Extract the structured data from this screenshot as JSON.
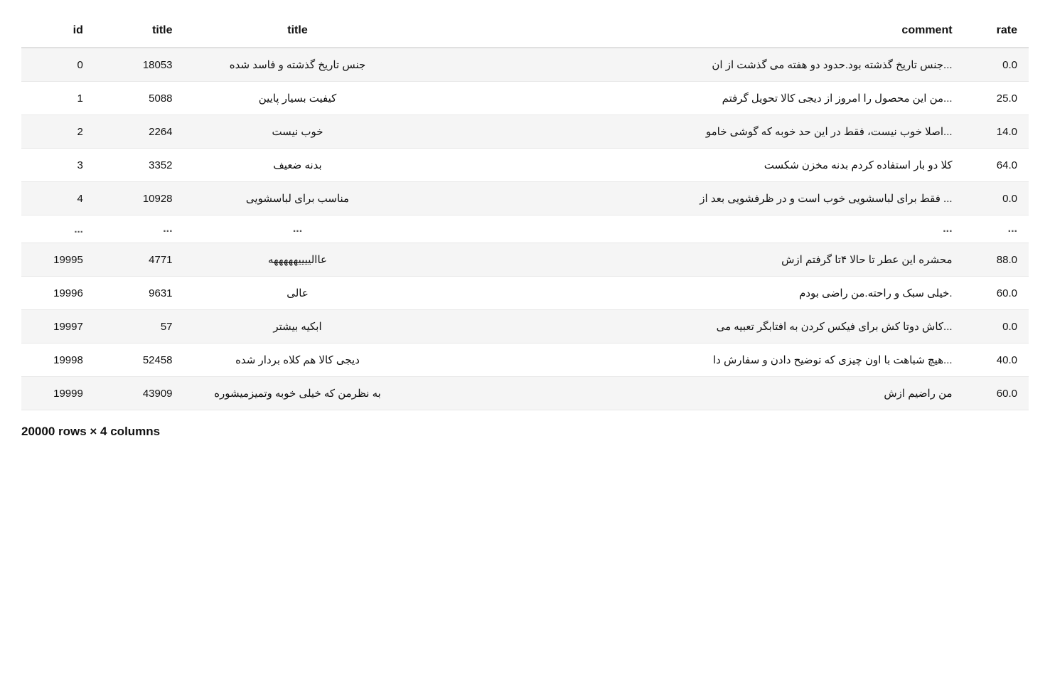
{
  "table": {
    "columns": {
      "id": "id",
      "title_id": "title",
      "title": "title",
      "comment": "comment",
      "rate": "rate"
    },
    "header": {
      "id_label": "id",
      "title_id_label": "title",
      "title_label": "title",
      "comment_label": "comment",
      "rate_label": "rate"
    },
    "rows": [
      {
        "id": "0",
        "title_id": "18053",
        "title": "جنس تاریخ گذشته و فاسد شده",
        "comment": "...جنس تاریخ گذشته بود.حدود دو هفته می گذشت از ان",
        "rate": "0.0"
      },
      {
        "id": "1",
        "title_id": "5088",
        "title": "کیفیت بسیار پایین",
        "comment": "...من این محصول را امروز از دیجی کالا تحویل گرفتم",
        "rate": "25.0"
      },
      {
        "id": "2",
        "title_id": "2264",
        "title": "خوب نیست",
        "comment": "...اصلا خوب نیست، فقط در این حد خوبه که گوشی خامو",
        "rate": "14.0"
      },
      {
        "id": "3",
        "title_id": "3352",
        "title": "بدنه ضعیف",
        "comment": "کلا دو بار استفاده کردم بدنه مخزن شکست",
        "rate": "64.0"
      },
      {
        "id": "4",
        "title_id": "10928",
        "title": "مناسب برای لباسشویی",
        "comment": "... فقط برای لباسشویی خوب است و در ظرفشویی بعد از",
        "rate": "0.0"
      }
    ],
    "ellipsis": {
      "id": "...",
      "title_id": "...",
      "title": "...",
      "comment": "...",
      "rate": "..."
    },
    "bottom_rows": [
      {
        "id": "19995",
        "title_id": "4771",
        "title": "عاالییییهههههه",
        "comment": "محشره این عطر تا حالا ۴تا گرفتم ازش",
        "rate": "88.0"
      },
      {
        "id": "19996",
        "title_id": "9631",
        "title": "عالی",
        "comment": ".خیلی سبک و راحته.من راضی بودم",
        "rate": "60.0"
      },
      {
        "id": "19997",
        "title_id": "57",
        "title": "ابکیه بیشتر",
        "comment": "...کاش دوتا کش برای فیکس کردن به افتابگر تعبیه می",
        "rate": "0.0"
      },
      {
        "id": "19998",
        "title_id": "52458",
        "title": "دیجی کالا هم کلاه بردار شده",
        "comment": "...هیچ شباهت با اون چیزی که توضیح دادن و سفارش دا",
        "rate": "40.0"
      },
      {
        "id": "19999",
        "title_id": "43909",
        "title": "به نظرمن که خیلی خوبه وتمیزمیشوره",
        "comment": "من راضیم ازش",
        "rate": "60.0"
      }
    ],
    "footer": "20000 rows × 4 columns"
  }
}
